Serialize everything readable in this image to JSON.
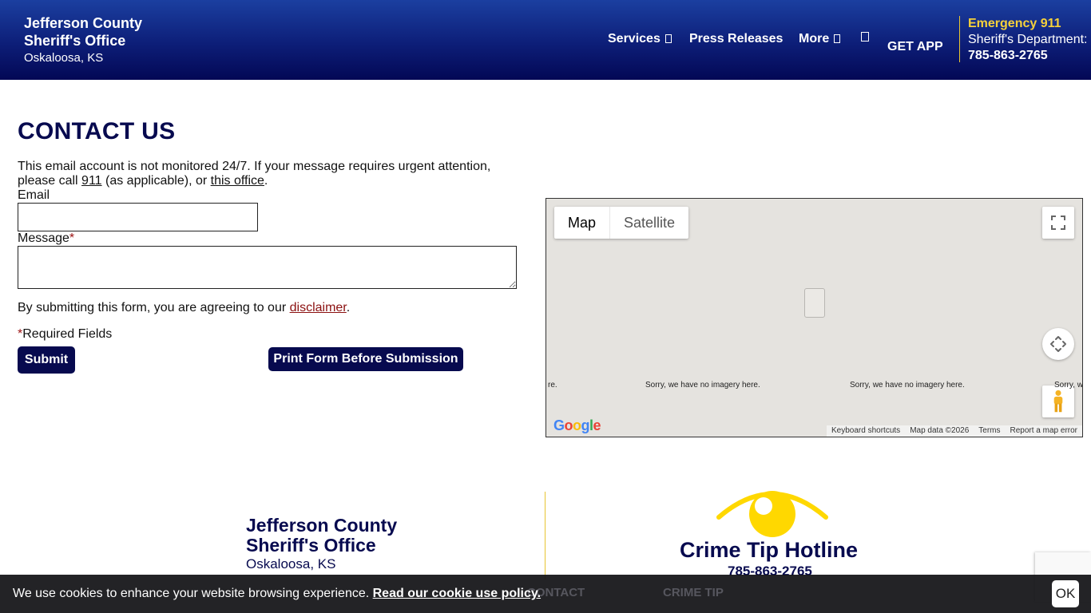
{
  "header": {
    "org_line1": "Jefferson County",
    "org_line2": "Sheriff's Office",
    "location": "Oskaloosa, KS",
    "nav": {
      "services": "Services",
      "press_releases": "Press Releases",
      "more": "More"
    },
    "get_app": "GET APP",
    "emergency_label": "Emergency 911",
    "dept_label": "Sheriff's Department:",
    "dept_phone": "785-863-2765"
  },
  "contact": {
    "title": "CONTACT US",
    "note_part1": "This email account is not monitored 24/7. If your message requires urgent attention, please call ",
    "note_link_911": "911",
    "note_part2": " (as applicable), or ",
    "note_link_office": "this office",
    "note_part3": ".",
    "email_label": "Email",
    "message_label": "Message",
    "required_mark": "*",
    "disclaimer_prefix": "By submitting this form, you are agreeing to our ",
    "disclaimer_link": "disclaimer",
    "disclaimer_suffix": ".",
    "required_fields": "Required Fields",
    "submit_label": "Submit",
    "print_label": "Print Form Before Submission"
  },
  "map": {
    "tab_map": "Map",
    "tab_satellite": "Satellite",
    "no_imagery": "Sorry, we have no imagery here.",
    "no_imagery_left": "re.",
    "no_imagery_right": "Sorry, w",
    "footer": {
      "shortcuts": "Keyboard shortcuts",
      "data": "Map data ©2026",
      "terms": "Terms",
      "report": "Report a map error"
    }
  },
  "footer": {
    "org_line1": "Jefferson County",
    "org_line2": "Sheriff's Office",
    "location": "Oskaloosa, KS",
    "hotline_title": "Crime Tip Hotline",
    "hotline_phone": "785-863-2765",
    "ghost_contact": "CONTACT",
    "ghost_crime_tip": "CRIME TIP"
  },
  "cookie": {
    "message": "We use cookies to enhance your website browsing experience. ",
    "policy_link": "Read our cookie use policy.",
    "ok_label": "OK"
  },
  "colors": {
    "header_dark": "#030855",
    "header_light": "#1b3fa0",
    "navy": "#070a4f",
    "gold": "#f6d13a",
    "eye_yellow": "#ffd800"
  }
}
